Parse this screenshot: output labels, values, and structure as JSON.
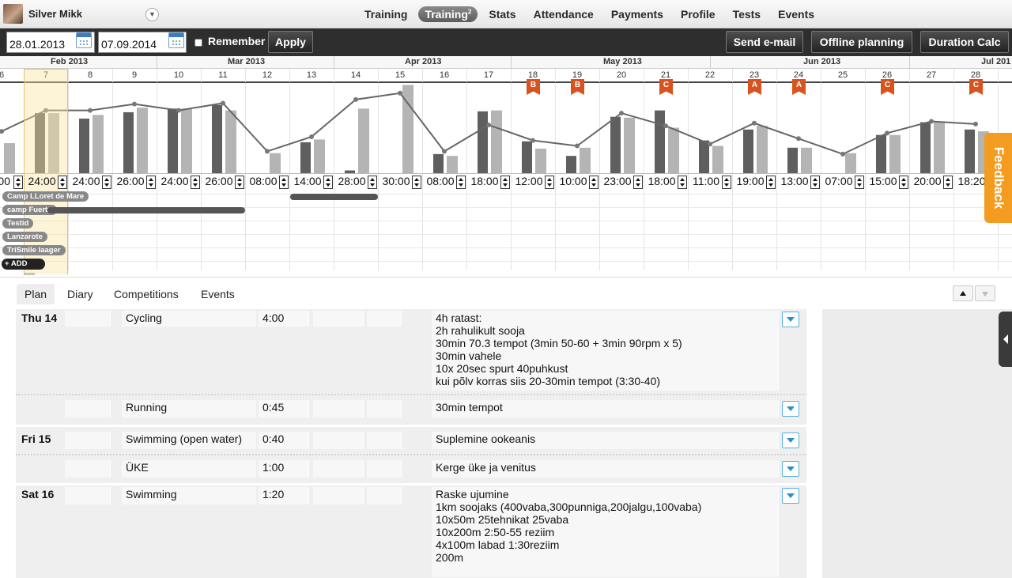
{
  "user": {
    "name": "Silver Mikk"
  },
  "nav": [
    {
      "label": "Training",
      "active": false
    },
    {
      "label": "Training",
      "sup": "2",
      "active": true
    },
    {
      "label": "Stats",
      "active": false
    },
    {
      "label": "Attendance",
      "active": false
    },
    {
      "label": "Payments",
      "active": false
    },
    {
      "label": "Profile",
      "active": false
    },
    {
      "label": "Tests",
      "active": false
    },
    {
      "label": "Events",
      "active": false
    }
  ],
  "toolbar": {
    "date_from": "28.01.2013",
    "date_to": "07.09.2014",
    "remember_label": "Remember",
    "apply_label": "Apply",
    "send_email_label": "Send e-mail",
    "offline_planning_label": "Offline planning",
    "duration_calc_label": "Duration Calc"
  },
  "calendar": {
    "months": [
      "Feb 2013",
      "Mar 2013",
      "Apr 2013",
      "May 2013",
      "Jun 2013",
      "Jul 201"
    ],
    "weeks": [
      "6",
      "7",
      "8",
      "9",
      "10",
      "11",
      "12",
      "13",
      "14",
      "15",
      "16",
      "17",
      "18",
      "19",
      "20",
      "21",
      "22",
      "23",
      "24",
      "25",
      "26",
      "27",
      "28"
    ],
    "durations": [
      "00",
      "24:00",
      "24:00",
      "26:00",
      "24:00",
      "26:00",
      "08:00",
      "14:00",
      "28:00",
      "30:00",
      "08:00",
      "18:00",
      "12:00",
      "10:00",
      "23:00",
      "18:00",
      "11:00",
      "19:00",
      "13:00",
      "07:00",
      "15:00",
      "20:00",
      "18:20"
    ],
    "markers": [
      {
        "week": "18",
        "label": "B"
      },
      {
        "week": "19",
        "label": "B"
      },
      {
        "week": "21",
        "label": "C"
      },
      {
        "week": "23",
        "label": "A"
      },
      {
        "week": "24",
        "label": "A"
      },
      {
        "week": "26",
        "label": "C"
      },
      {
        "week": "28",
        "label": "C"
      }
    ],
    "camps": [
      "Camp LLoret de Mare",
      "camp Fuerte",
      "Testid",
      "Lanzarote",
      "TriSmile laager"
    ],
    "add_label": "ADD",
    "selected_week": "7",
    "bars_planned": [
      0,
      0.66,
      0.6,
      0.67,
      0.71,
      0.75,
      0,
      0.34,
      0.03,
      0,
      0.21,
      0.68,
      0.35,
      0.19,
      0.62,
      0.69,
      0.36,
      0.48,
      0.28,
      0,
      0.42,
      0.56,
      0.48
    ],
    "bars_actual": [
      0.33,
      0.66,
      0.64,
      0.72,
      0.71,
      0.69,
      0.22,
      0.37,
      0.71,
      0.97,
      0.19,
      0.69,
      0.27,
      0.28,
      0.61,
      0.5,
      0.3,
      0.52,
      0.28,
      0.22,
      0.42,
      0.57,
      0.46
    ],
    "line": [
      0.46,
      0.69,
      0.69,
      0.76,
      0.69,
      0.77,
      0.24,
      0.4,
      0.81,
      0.88,
      0.24,
      0.53,
      0.36,
      0.3,
      0.66,
      0.52,
      0.32,
      0.55,
      0.38,
      0.21,
      0.44,
      0.57,
      0.54
    ]
  },
  "tabs": [
    "Plan",
    "Diary",
    "Competitions",
    "Events"
  ],
  "plan": [
    {
      "day": "Thu 14",
      "sport": "Cycling",
      "duration": "4:00",
      "notes": "4h ratast:\n2h rahulikult sooja\n30min 70.3 tempot (3min 50-60 + 3min 90rpm x 5)\n30min vahele\n10x 20sec spurt 40puhkust\nkui põlv korras siis 20-30min tempot (3:30-40)"
    },
    {
      "day": "",
      "sport": "Running",
      "duration": "0:45",
      "notes": "30min tempot"
    },
    {
      "day": "Fri 15",
      "sport": "Swimming (open water)",
      "duration": "0:40",
      "notes": "Suplemine ookeanis"
    },
    {
      "day": "",
      "sport": "ÜKE",
      "duration": "1:00",
      "notes": "Kerge üke ja venitus"
    },
    {
      "day": "Sat 16",
      "sport": "Swimming",
      "duration": "1:20",
      "notes": "Raske ujumine\n1km soojaks (400vaba,300punniga,200jalgu,100vaba)\n10x50m 25tehnikat 25vaba\n10x200m 2:50-55 reziim\n4x100m labad 1:30reziim\n200m"
    }
  ],
  "feedback_label": "Feedback"
}
